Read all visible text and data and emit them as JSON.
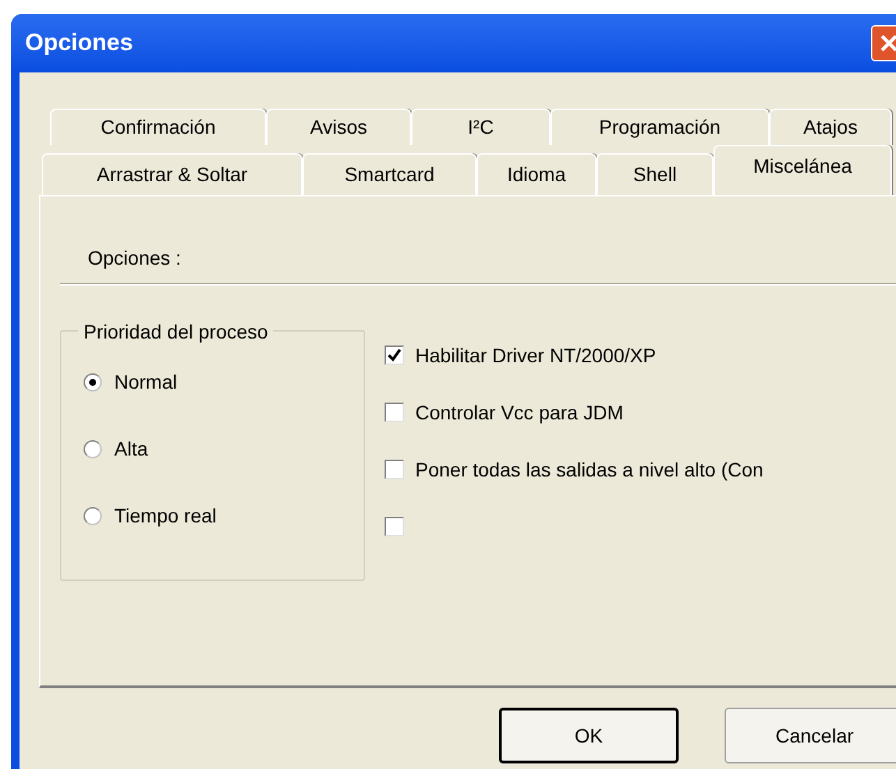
{
  "window": {
    "title": "Opciones"
  },
  "tab_rows": [
    [
      {
        "label": "Confirmación",
        "selected": false
      },
      {
        "label": "Avisos",
        "selected": false
      },
      {
        "label": "I²C",
        "selected": false
      },
      {
        "label": "Programación",
        "selected": false
      },
      {
        "label": "Atajos",
        "selected": false
      }
    ],
    [
      {
        "label": "Arrastrar & Soltar",
        "selected": false
      },
      {
        "label": "Smartcard",
        "selected": false
      },
      {
        "label": "Idioma",
        "selected": false
      },
      {
        "label": "Shell",
        "selected": false
      },
      {
        "label": "Miscelánea",
        "selected": true
      }
    ]
  ],
  "section_label": "Opciones :",
  "priority_group": {
    "title": "Prioridad del proceso",
    "options": [
      {
        "label": "Normal",
        "selected": true
      },
      {
        "label": "Alta",
        "selected": false
      },
      {
        "label": "Tiempo real",
        "selected": false
      }
    ]
  },
  "checkboxes": [
    {
      "label": "Habilitar Driver NT/2000/XP",
      "checked": true
    },
    {
      "label": "Controlar Vcc para JDM",
      "checked": false
    },
    {
      "label": "Poner todas las salidas a nivel alto (Con",
      "checked": false
    },
    {
      "checked": false
    }
  ],
  "buttons": [
    {
      "label": "OK",
      "default": true
    },
    {
      "label": "Cancelar",
      "default": false
    }
  ]
}
